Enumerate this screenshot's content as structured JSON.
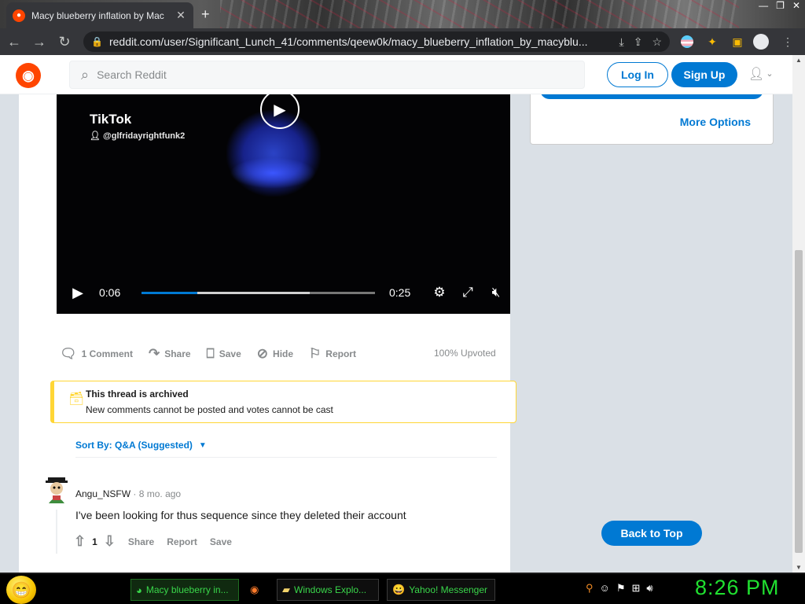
{
  "browser": {
    "tab_title": "Macy blueberry inflation by Mac",
    "url": "reddit.com/user/Significant_Lunch_41/comments/qeew0k/macy_blueberry_inflation_by_macyblu..."
  },
  "header": {
    "search_placeholder": "Search Reddit",
    "login_label": "Log In",
    "signup_label": "Sign Up"
  },
  "video": {
    "platform_label": "TikTok",
    "handle": "@glfridayrightfunk2",
    "current_time": "0:06",
    "duration": "0:25",
    "progress_fraction": 0.24,
    "buffered_fraction": 0.72
  },
  "post_actions": {
    "comments": "1 Comment",
    "share": "Share",
    "save": "Save",
    "hide": "Hide",
    "report": "Report",
    "upvoted": "100% Upvoted"
  },
  "archived": {
    "title": "This thread is archived",
    "message": "New comments cannot be posted and votes cannot be cast"
  },
  "sort": {
    "label": "Sort By: Q&A (Suggested)"
  },
  "comment": {
    "author": "Angu_NSFW",
    "separator": "·",
    "age": "8 mo. ago",
    "body": "I've been looking for thus sequence since they deleted their account",
    "score": "1",
    "share": "Share",
    "report": "Report",
    "save": "Save"
  },
  "sidebar": {
    "more_options": "More Options"
  },
  "back_to_top": "Back to Top",
  "taskbar": {
    "items": [
      "Macy blueberry in...",
      "Windows Explo...",
      "Yahoo! Messenger"
    ],
    "clock": "8:26 PM"
  },
  "colors": {
    "reddit_orange": "#ff4500",
    "reddit_blue": "#0079d3",
    "archived_yellow": "#ffd635",
    "clock_green": "#20e030"
  }
}
